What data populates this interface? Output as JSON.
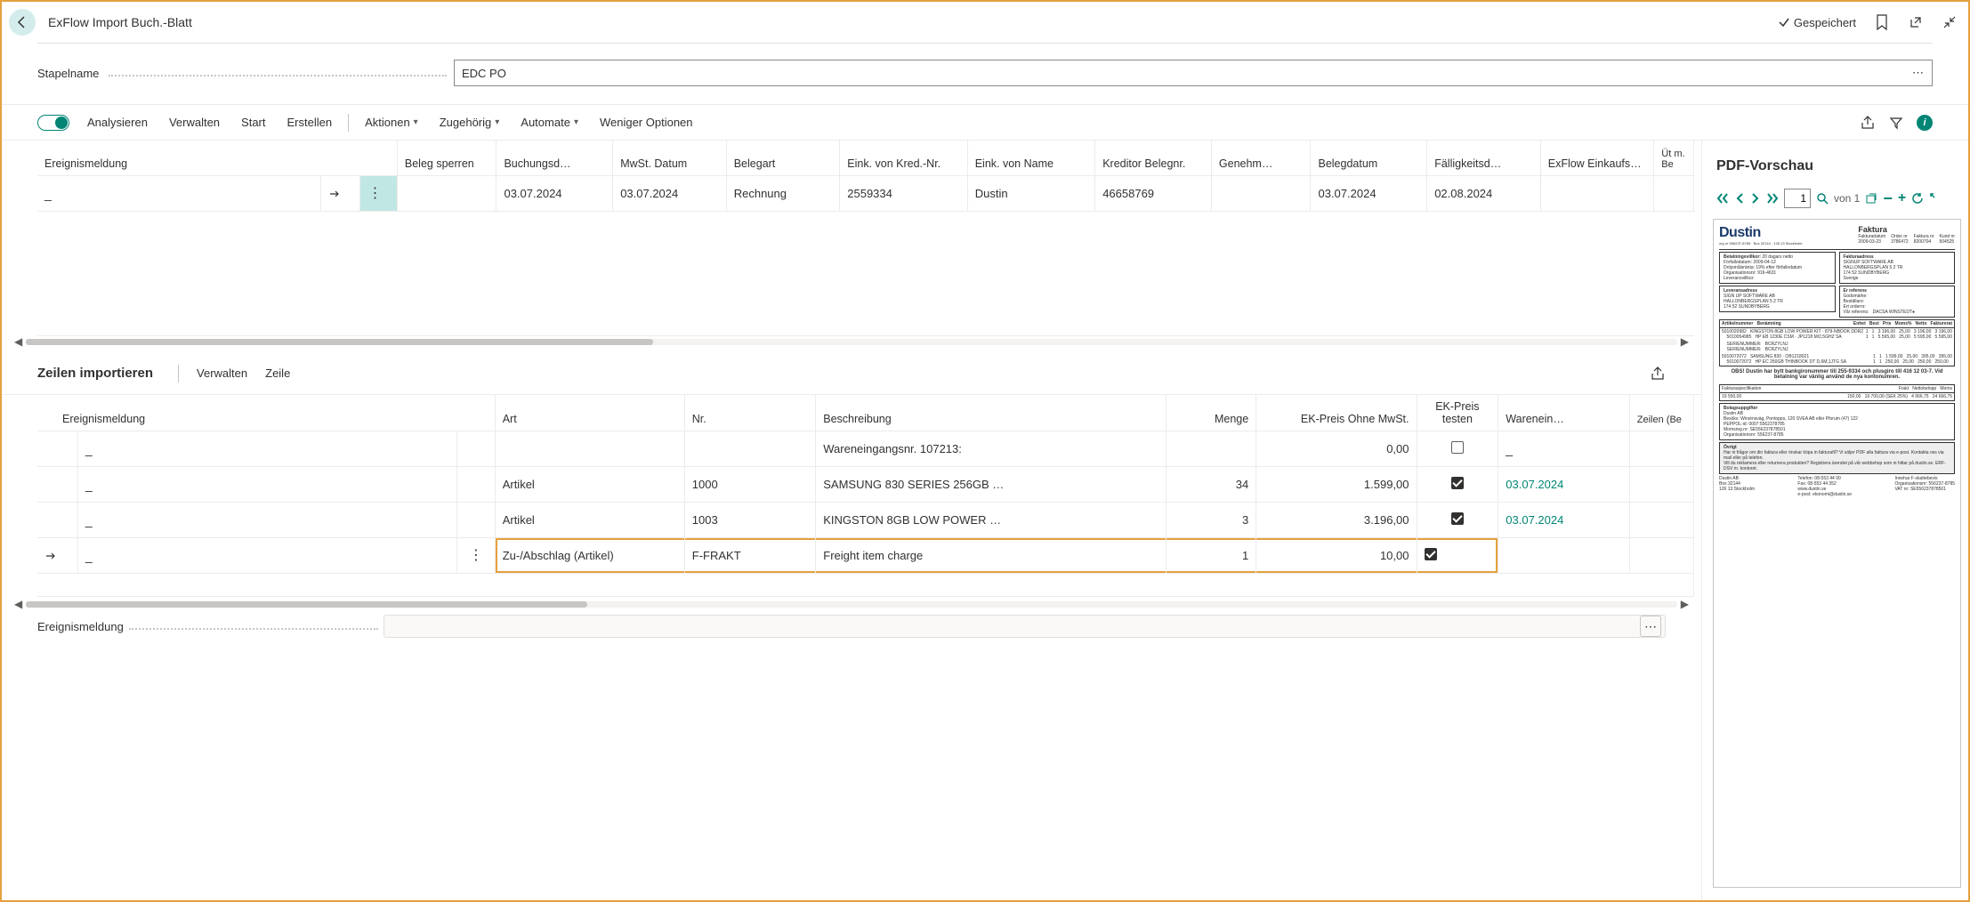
{
  "page": {
    "title": "ExFlow Import Buch.-Blatt",
    "saved_label": "Gespeichert"
  },
  "field": {
    "label": "Stapelname",
    "value": "EDC PO"
  },
  "actionbar": {
    "analyze": "Analysieren",
    "manage": "Verwalten",
    "start": "Start",
    "create": "Erstellen",
    "actions": "Aktionen",
    "related": "Zugehörig",
    "automate": "Automate",
    "fewer": "Weniger Optionen"
  },
  "header_table": {
    "cols": [
      "Ereignismeldung",
      "",
      "",
      "Beleg sperren",
      "Buchungsd…",
      "MwSt. Datum",
      "Belegart",
      "Eink. von Kred.-Nr.",
      "Eink. von Name",
      "Kreditor Belegnr.",
      "Genehm…",
      "Belegdatum",
      "Fälligkeitsd…",
      "ExFlow Einkaufsc…",
      "Üt m. Be"
    ],
    "row": {
      "event": "_",
      "buchungsd": "03.07.2024",
      "mwst": "03.07.2024",
      "belegart": "Rechnung",
      "eink_nr": "2559334",
      "eink_name": "Dustin",
      "kreditor_nr": "46658769",
      "genehm": "",
      "belegdatum": "03.07.2024",
      "faellig": "02.08.2024",
      "exflow": ""
    }
  },
  "lines": {
    "title": "Zeilen importieren",
    "manage": "Verwalten",
    "line": "Zeile",
    "cols": [
      "Ereignismeldung",
      "",
      "Art",
      "Nr.",
      "Beschreibung",
      "Menge",
      "EK-Preis Ohne MwSt.",
      "EK-Preis testen",
      "Warenein…",
      "Zeilen (Be"
    ],
    "rows": [
      {
        "event": "_",
        "art": "",
        "nr": "",
        "besch": "Wareneingangsnr. 107213:",
        "menge": "",
        "preis": "0,00",
        "testen": false,
        "waren": "_"
      },
      {
        "event": "_",
        "art": "Artikel",
        "nr": "1000",
        "besch": "SAMSUNG 830 SERIES 256GB …",
        "menge": "34",
        "preis": "1.599,00",
        "testen": true,
        "waren": "03.07.2024",
        "waren_link": true
      },
      {
        "event": "_",
        "art": "Artikel",
        "nr": "1003",
        "besch": "KINGSTON 8GB LOW POWER …",
        "menge": "3",
        "preis": "3.196,00",
        "testen": true,
        "waren": "03.07.2024",
        "waren_link": true
      },
      {
        "event": "_",
        "art": "Zu-/Abschlag (Artikel)",
        "nr": "F-FRAKT",
        "besch": "Freight item charge",
        "menge": "1",
        "preis": "10,00",
        "testen": true,
        "waren": "",
        "highlight": true,
        "current": true
      }
    ]
  },
  "footer": {
    "label": "Ereignismeldung"
  },
  "pdf": {
    "title": "PDF-Vorschau",
    "page_input": "1",
    "von": "von 1",
    "logo": "Dustin",
    "heading": "Faktura",
    "note": "OBS! Dustin har bytt bankgironummer till 255-9334 och plusgiro till 416 12 03-7. Vid betalning var vänlig använd de nya kontonumren."
  }
}
